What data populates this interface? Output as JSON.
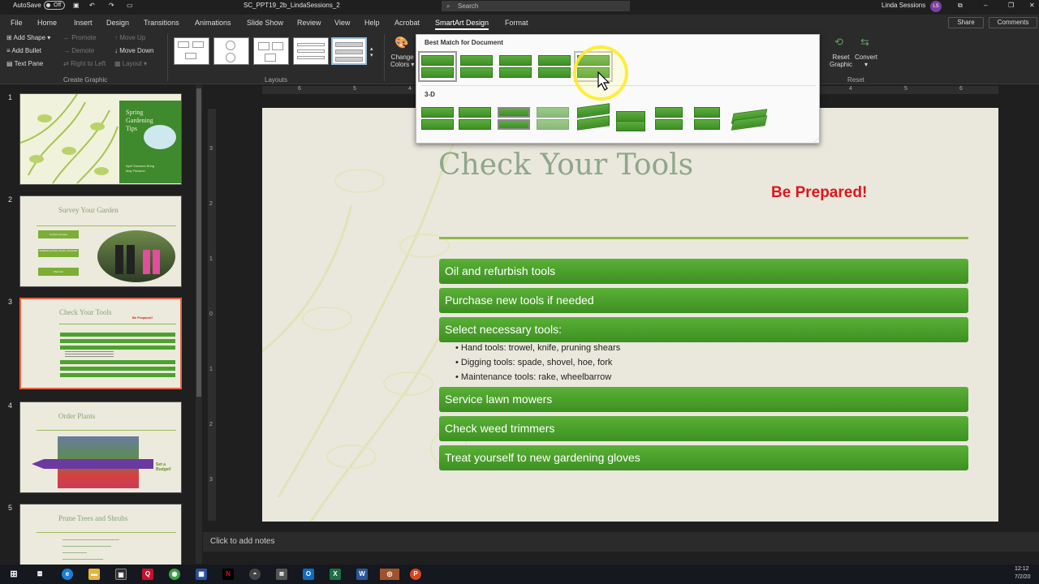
{
  "titlebar": {
    "autosave_label": "AutoSave",
    "autosave_state": "Off",
    "filename": "SC_PPT19_2b_LindaSessions_2",
    "search_placeholder": "Search",
    "user_name": "Linda Sessions",
    "user_initials": "LS"
  },
  "tabs": [
    "File",
    "Home",
    "Insert",
    "Design",
    "Transitions",
    "Animations",
    "Slide Show",
    "Review",
    "View",
    "Help",
    "Acrobat",
    "SmartArt Design",
    "Format"
  ],
  "active_tab": "SmartArt Design",
  "share_label": "Share",
  "comments_label": "Comments",
  "ribbon": {
    "create_graphic": {
      "add_shape": "Add Shape",
      "add_bullet": "Add Bullet",
      "text_pane": "Text Pane",
      "promote": "Promote",
      "demote": "Demote",
      "right_to_left": "Right to Left",
      "move_up": "Move Up",
      "move_down": "Move Down",
      "layout": "Layout",
      "group_label": "Create Graphic"
    },
    "layouts_label": "Layouts",
    "change_colors_line1": "Change",
    "change_colors_line2": "Colors",
    "reset_graphic_line1": "Reset",
    "reset_graphic_line2": "Graphic",
    "convert_label": "Convert",
    "reset_group_label": "Reset"
  },
  "gallery": {
    "section1": "Best Match for Document",
    "section2": "3-D"
  },
  "ruler": {
    "h_marks": [
      "6",
      "5",
      "4",
      "4",
      "5",
      "6"
    ],
    "v_marks": [
      "3",
      "2",
      "1",
      "0",
      "1",
      "2",
      "3"
    ]
  },
  "thumbnails": [
    {
      "num": "1",
      "title_lines": [
        "Spring",
        "Gardening",
        "Tips"
      ],
      "subtitle_lines": [
        "April Showers Bring",
        "May Flowers!"
      ]
    },
    {
      "num": "2",
      "title": "Survey Your Garden",
      "boxes": [
        "Current soil type",
        "Establish growth, weeds, and pests",
        "Plant list"
      ]
    },
    {
      "num": "3",
      "title": "Check Your Tools",
      "note": "Be Prepared!"
    },
    {
      "num": "4",
      "title": "Order Plants",
      "callout": "Set a Budget!"
    },
    {
      "num": "5",
      "title": "Prune Trees and Shrubs"
    }
  ],
  "slide": {
    "title": "Check Your Tools",
    "callout": "Be Prepared!",
    "items_top": [
      "Oil and refurbish tools",
      "Purchase new tools if needed",
      "Select necessary tools:"
    ],
    "bullets": [
      "Hand tools: trowel, knife, pruning shears",
      "Digging tools: spade, shovel, hoe, fork",
      "Maintenance tools: rake, wheelbarrow"
    ],
    "items_bottom": [
      "Service lawn mowers",
      "Check weed trimmers",
      "Treat yourself to new gardening gloves"
    ]
  },
  "notes_placeholder": "Click to add notes",
  "clock": {
    "time": "12:12",
    "date": "7/2/20"
  },
  "colors": {
    "smartart_green": "#4ca22f",
    "accent_red": "#e0141a",
    "title_green": "#8fa68a",
    "active_thumb": "#e86548"
  }
}
